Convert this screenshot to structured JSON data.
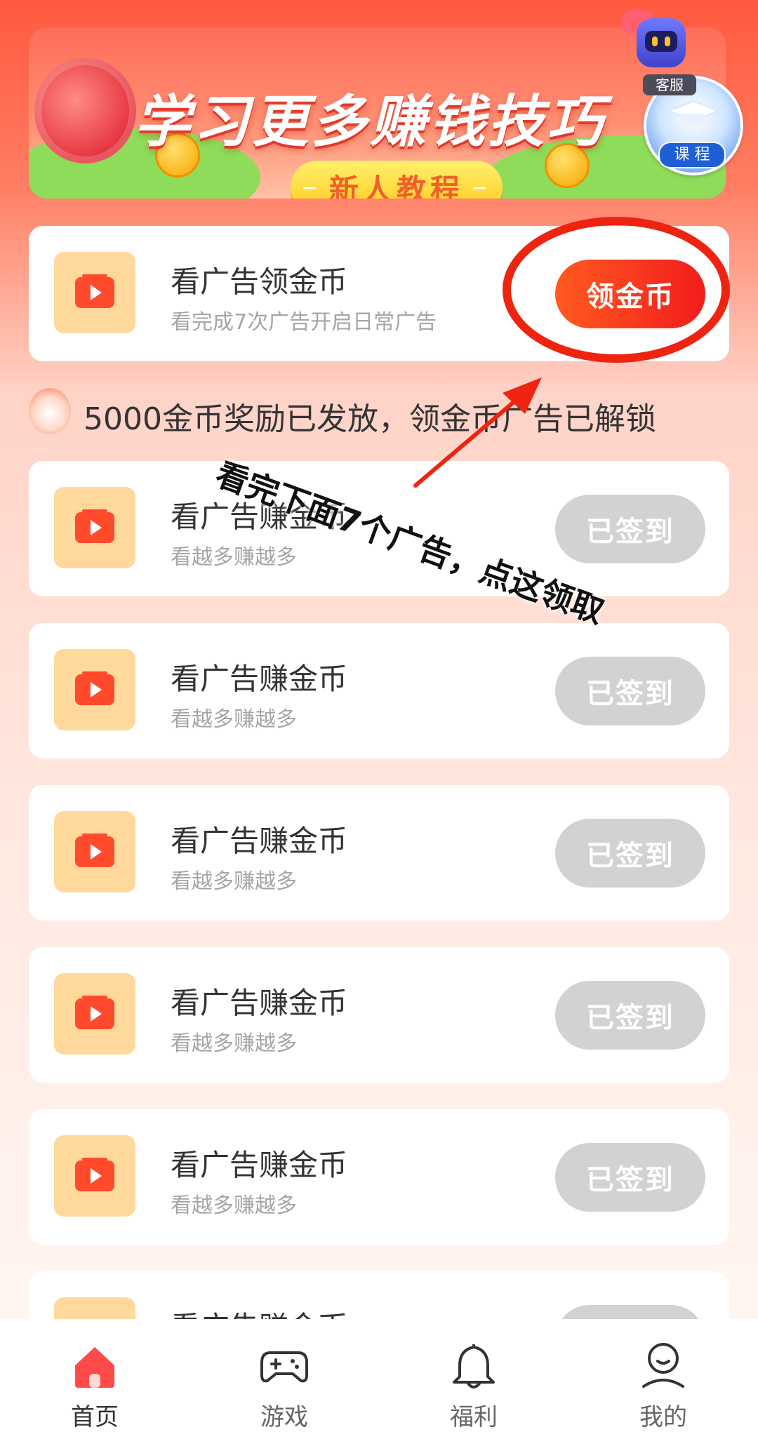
{
  "banner": {
    "title": "学习更多赚钱技巧",
    "button_label": "新人教程"
  },
  "floating": {
    "support_label": "客服",
    "course_label": "课 程"
  },
  "top_card": {
    "title": "看广告领金币",
    "subtitle": "看完成7次广告开启日常广告",
    "button_label": "领金币"
  },
  "notice": {
    "text": "5000金币奖励已发放，领金币广告已解锁"
  },
  "annotation": {
    "text": "看完下面7个广告，点这领取"
  },
  "ad_cards": [
    {
      "title": "看广告赚金币",
      "subtitle": "看越多赚越多",
      "button_label": "已签到"
    },
    {
      "title": "看广告赚金币",
      "subtitle": "看越多赚越多",
      "button_label": "已签到"
    },
    {
      "title": "看广告赚金币",
      "subtitle": "看越多赚越多",
      "button_label": "已签到"
    },
    {
      "title": "看广告赚金币",
      "subtitle": "看越多赚越多",
      "button_label": "已签到"
    },
    {
      "title": "看广告赚金币",
      "subtitle": "看越多赚越多",
      "button_label": "已签到"
    },
    {
      "title": "看广告赚金币",
      "subtitle": "",
      "button_label": ""
    }
  ],
  "bottom_nav": [
    {
      "label": "首页",
      "icon": "home-icon",
      "active": true
    },
    {
      "label": "游戏",
      "icon": "gamepad-icon",
      "active": false
    },
    {
      "label": "福利",
      "icon": "bell-icon",
      "active": false
    },
    {
      "label": "我的",
      "icon": "profile-icon",
      "active": false
    }
  ],
  "colors": {
    "accent": "#ff4a2a",
    "active_button": "#f23a1e",
    "done_button": "#d2d2d2",
    "icon_bg": "#ffd99c",
    "nav_active": "#ff4a4a",
    "nav_inactive": "#333333"
  }
}
